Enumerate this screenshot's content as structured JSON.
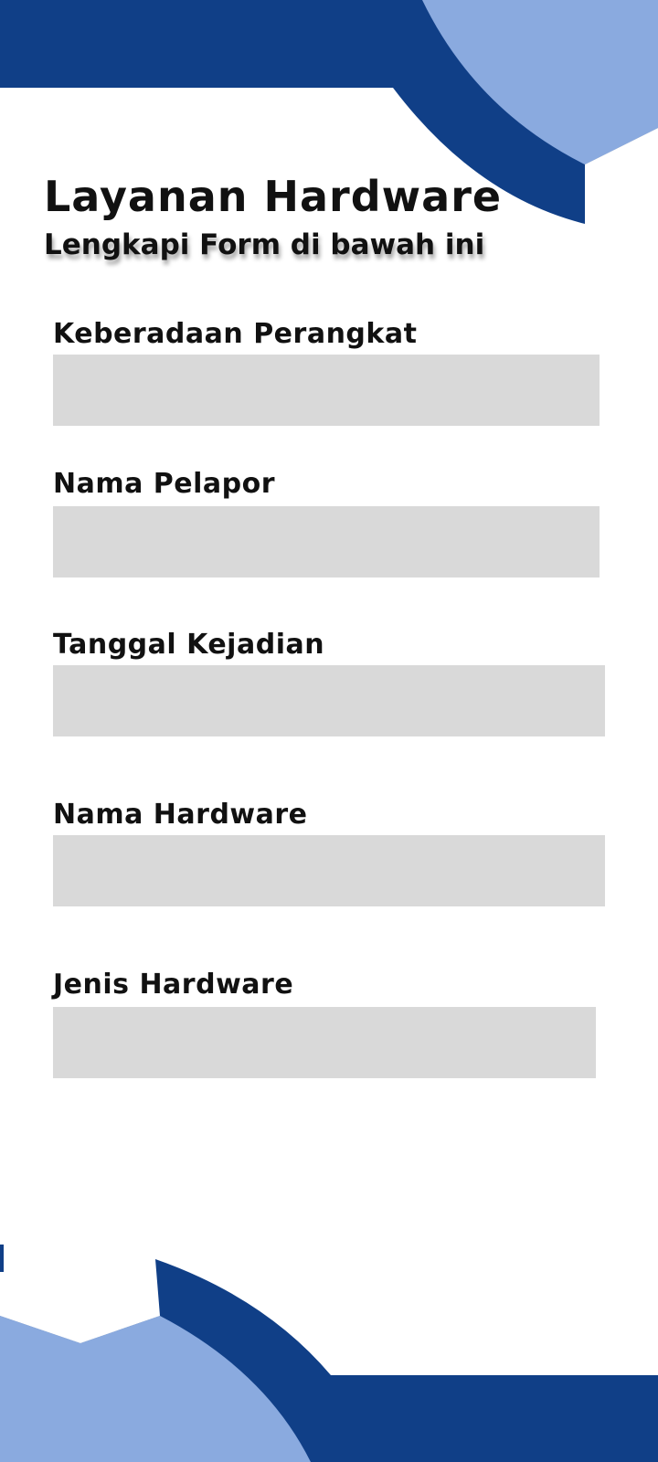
{
  "header": {
    "title": "Layanan Hardware",
    "subtitle": "Lengkapi Form di bawah ini"
  },
  "form": {
    "fields": [
      {
        "label": "Keberadaan Perangkat",
        "value": ""
      },
      {
        "label": "Nama Pelapor",
        "value": ""
      },
      {
        "label": "Tanggal Kejadian",
        "value": ""
      },
      {
        "label": "Nama Hardware",
        "value": ""
      },
      {
        "label": "Jenis Hardware",
        "value": ""
      }
    ]
  },
  "colors": {
    "dark_blue": "#103f87",
    "light_blue": "#8aaadf",
    "input_bg": "#d9d9d9"
  }
}
